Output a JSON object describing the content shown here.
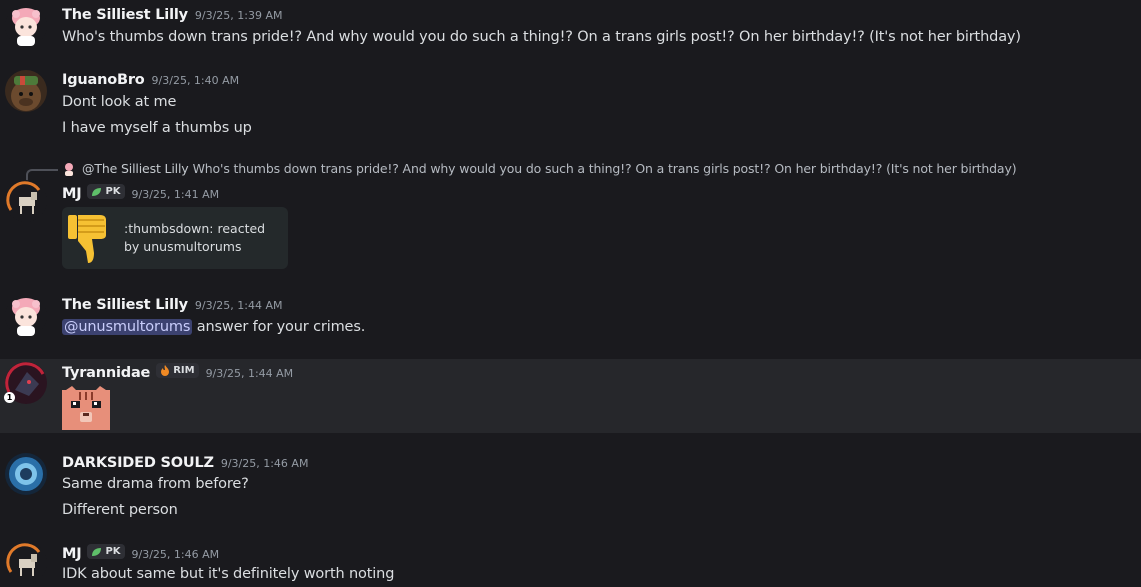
{
  "messages": {
    "m1": {
      "author": "The Silliest Lilly",
      "timestamp": "9/3/25, 1:39 AM",
      "text": "Who's thumbs down trans pride!? And why would you do such a thing!? On a trans girls post!? On her birthday!? (It's not her birthday)"
    },
    "m2": {
      "author": "IguanoBro",
      "timestamp": "9/3/25, 1:40 AM",
      "lines": [
        "Dont look at me",
        "I have myself a thumbs up"
      ]
    },
    "m3": {
      "reply": {
        "author": "@The Silliest Lilly",
        "text": "Who's thumbs down trans pride!? And why would you do such a thing!? On a trans girls post!? On her birthday!? (It's not her birthday)"
      },
      "author": "MJ",
      "tag": "PK",
      "timestamp": "9/3/25, 1:41 AM",
      "embed_text": ":thumbsdown: reacted by unusmultorums"
    },
    "m4": {
      "author": "The Silliest Lilly",
      "timestamp": "9/3/25, 1:44 AM",
      "mention": "@unusmultorums",
      "text": " answer for your crimes."
    },
    "m5": {
      "author": "Tyrannidae",
      "tag": "RIM",
      "timestamp": "9/3/25, 1:44 AM",
      "badge": "1"
    },
    "m6": {
      "author": "DARKSIDED SOULZ",
      "timestamp": "9/3/25, 1:46 AM",
      "lines": [
        "Same drama from before?",
        "Different person"
      ]
    },
    "m7": {
      "author": "MJ",
      "tag": "PK",
      "timestamp": "9/3/25, 1:46 AM",
      "text": "IDK about same but it's definitely worth noting"
    }
  },
  "colors": {
    "background": "#1a1a1e",
    "highlight_row": "#26272b",
    "mention_bg": "#3c4270",
    "embed_bg": "#24292b"
  },
  "icons": {
    "pk_tag": "leaf-icon",
    "rim_tag": "fire-icon",
    "embed": "thumbs-down-emoji",
    "sticker": "cat-face-emoji"
  }
}
